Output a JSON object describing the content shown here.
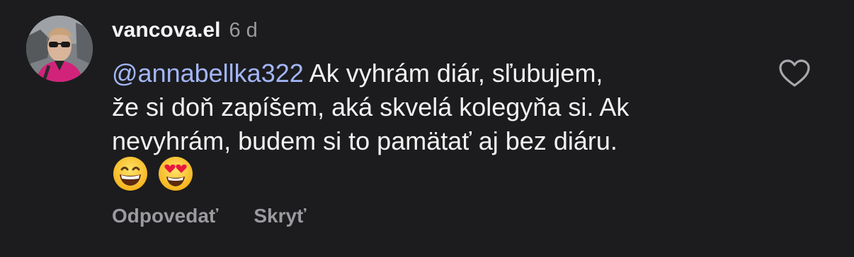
{
  "comment": {
    "username": "vancova.el",
    "time_ago": "6 d",
    "mention": "@annabellka322",
    "text_line1": " Ak vyhrám diár, sľubujem,",
    "text_line2": "že si doň zapíšem, aká skvelá kolegyňa si. Ak",
    "text_line3": "nevyhrám, budem si to pamätať aj bez diáru.",
    "emojis": [
      "grinning-face-with-smiling-eyes",
      "smiling-face-with-heart-eyes"
    ],
    "mention_color": "#a3b6f7"
  },
  "actions": {
    "reply_label": "Odpovedať",
    "hide_label": "Skryť"
  },
  "icons": {
    "like": "heart-outline-icon",
    "avatar": "user-avatar-photo"
  }
}
